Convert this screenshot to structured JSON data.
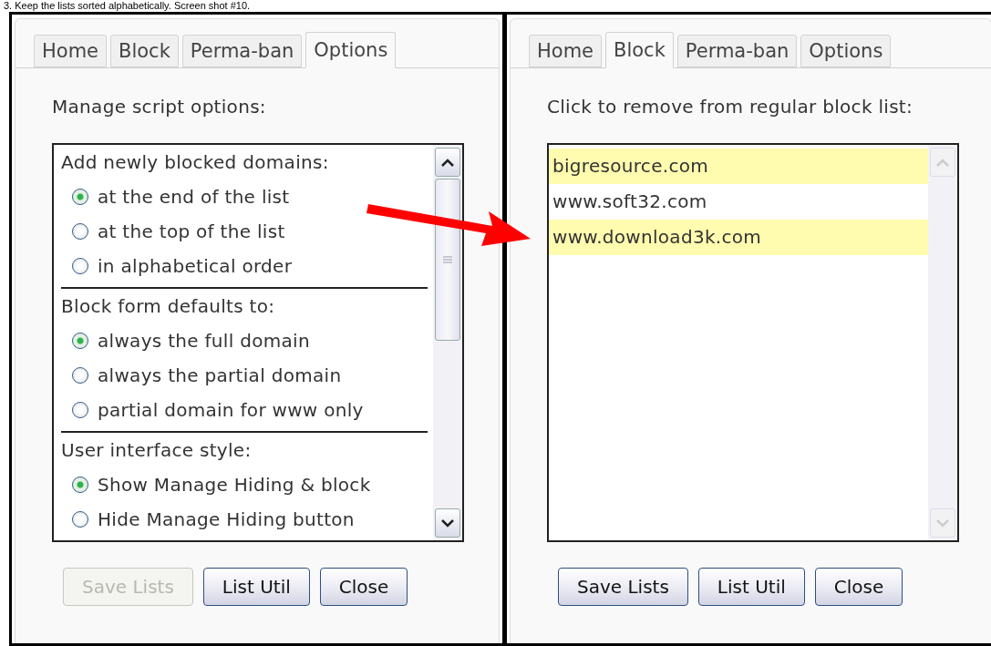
{
  "caption": "3. Keep the lists sorted alphabetically. Screen shot #10.",
  "panels": [
    {
      "kind": "options",
      "tabs": [
        {
          "label": "Home",
          "selected": false
        },
        {
          "label": "Block",
          "selected": false
        },
        {
          "label": "Perma-ban",
          "selected": false
        },
        {
          "label": "Options",
          "selected": true
        }
      ],
      "instruction": "Manage script options:",
      "groups": [
        {
          "heading": "Add newly blocked domains:",
          "options": [
            {
              "label": "at the end of the list",
              "selected": true
            },
            {
              "label": "at the top of the list",
              "selected": false
            },
            {
              "label": "in alphabetical order",
              "selected": false
            }
          ]
        },
        {
          "heading": "Block form defaults to:",
          "options": [
            {
              "label": "always the full domain",
              "selected": true
            },
            {
              "label": "always the partial domain",
              "selected": false
            },
            {
              "label": "partial domain for www only",
              "selected": false
            }
          ]
        },
        {
          "heading": "User interface style:",
          "options": [
            {
              "label": "Show Manage Hiding & block",
              "selected": true
            },
            {
              "label": "Hide Manage Hiding button",
              "selected": false
            }
          ]
        }
      ],
      "buttons": [
        {
          "label": "Save Lists",
          "disabled": true
        },
        {
          "label": "List Util",
          "disabled": false
        },
        {
          "label": "Close",
          "disabled": false
        }
      ]
    },
    {
      "kind": "domains",
      "tabs": [
        {
          "label": "Home",
          "selected": false
        },
        {
          "label": "Block",
          "selected": true
        },
        {
          "label": "Perma-ban",
          "selected": false
        },
        {
          "label": "Options",
          "selected": false
        }
      ],
      "instruction": "Click to remove from regular block list:",
      "domains": [
        {
          "text": "bigresource.com",
          "highlighted": true
        },
        {
          "text": "www.soft32.com",
          "highlighted": false
        },
        {
          "text": "www.download3k.com",
          "highlighted": true
        }
      ],
      "buttons": [
        {
          "label": "Save Lists",
          "disabled": false
        },
        {
          "label": "List Util",
          "disabled": false
        },
        {
          "label": "Close",
          "disabled": false
        }
      ]
    }
  ]
}
